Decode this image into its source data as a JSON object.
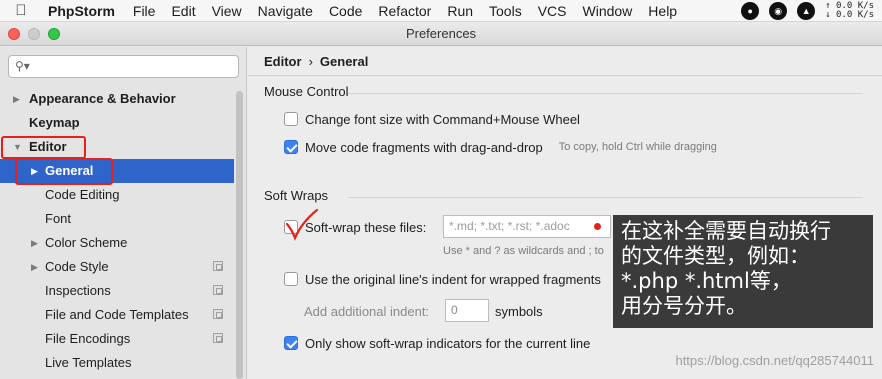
{
  "menubar": {
    "app_name": "PhpStorm",
    "items": [
      "File",
      "Edit",
      "View",
      "Navigate",
      "Code",
      "Refactor",
      "Run",
      "Tools",
      "VCS",
      "Window",
      "Help"
    ],
    "net_up": "↑ 0.0 K/s",
    "net_down": "↓ 0.0 K/s"
  },
  "window": {
    "title": "Preferences"
  },
  "sidebar": {
    "search_placeholder": "",
    "items": [
      {
        "label": "Appearance & Behavior"
      },
      {
        "label": "Keymap"
      },
      {
        "label": "Editor"
      },
      {
        "label": "General"
      },
      {
        "label": "Code Editing"
      },
      {
        "label": "Font"
      },
      {
        "label": "Color Scheme"
      },
      {
        "label": "Code Style"
      },
      {
        "label": "Inspections"
      },
      {
        "label": "File and Code Templates"
      },
      {
        "label": "File Encodings"
      },
      {
        "label": "Live Templates"
      }
    ]
  },
  "breadcrumb": {
    "parent": "Editor",
    "separator": "›",
    "current": "General"
  },
  "mouse_control": {
    "title": "Mouse Control",
    "options": [
      {
        "label": "Change font size with Command+Mouse Wheel",
        "checked": false
      },
      {
        "label": "Move code fragments with drag-and-drop",
        "checked": true,
        "hint": "To copy, hold Ctrl while dragging"
      }
    ]
  },
  "soft_wraps": {
    "title": "Soft Wraps",
    "wrap_files_label": "Soft-wrap these files:",
    "wrap_files_checked": false,
    "wrap_files_placeholder": "*.md; *.txt; *.rst; *.adoc",
    "wildcard_hint": "Use * and ? as wildcards and ; to",
    "indent_label": "Use the original line's indent for wrapped fragments",
    "indent_checked": false,
    "additional_indent_label": "Add additional indent:",
    "additional_indent_value": "0",
    "symbols_label": "symbols",
    "indicators_label": "Only show soft-wrap indicators for the current line",
    "indicators_checked": true
  },
  "annotation": {
    "lines": [
      "在这补全需要自动换行",
      "的文件类型，例如：",
      "*.php *.html等，",
      "用分号分开。"
    ]
  },
  "watermark": "https://blog.csdn.net/qq285744011",
  "colors": {
    "selection": "#2f65ca",
    "highlight_red": "#e8201a",
    "checkbox_on": "#3b82f3"
  }
}
